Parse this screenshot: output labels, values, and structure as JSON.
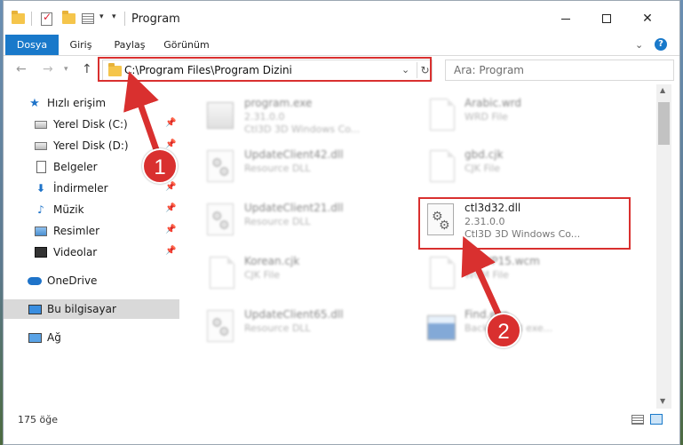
{
  "window": {
    "title": "Program"
  },
  "ribbon": {
    "tabs": [
      {
        "label": "Dosya"
      },
      {
        "label": "Giriş"
      },
      {
        "label": "Paylaş"
      },
      {
        "label": "Görünüm"
      }
    ]
  },
  "navigation": {
    "address": "C:\\Program Files\\Program Dizini",
    "search_placeholder": "Ara: Program"
  },
  "sidebar": {
    "items": [
      {
        "label": "Hızlı erişim",
        "icon": "star-icon"
      },
      {
        "label": "Yerel Disk (C:)",
        "icon": "drive-icon",
        "pinned": true
      },
      {
        "label": "Yerel Disk (D:)",
        "icon": "drive-icon",
        "pinned": true
      },
      {
        "label": "Belgeler",
        "icon": "document-icon",
        "pinned": true
      },
      {
        "label": "İndirmeler",
        "icon": "download-icon",
        "pinned": true
      },
      {
        "label": "Müzik",
        "icon": "music-icon",
        "pinned": true
      },
      {
        "label": "Resimler",
        "icon": "pictures-icon",
        "pinned": true
      },
      {
        "label": "Videolar",
        "icon": "video-icon",
        "pinned": true
      },
      {
        "label": "OneDrive",
        "icon": "cloud-icon"
      },
      {
        "label": "Bu bilgisayar",
        "icon": "computer-icon",
        "selected": true
      },
      {
        "label": "Ağ",
        "icon": "network-icon"
      }
    ]
  },
  "files": [
    {
      "name": "program.exe",
      "line1": "2.31.0.0",
      "line2": "Ctl3D 3D Windows Co...",
      "icon": "exe-icon",
      "blurred": true
    },
    {
      "name": "Arabic.wrd",
      "line1": "WRD File",
      "line2": "",
      "icon": "page-icon",
      "blurred": true
    },
    {
      "name": "UpdateClient42.dll",
      "line1": "Resource DLL",
      "line2": "",
      "icon": "gear-file-icon",
      "blurred": true
    },
    {
      "name": "gbd.cjk",
      "line1": "CJK File",
      "line2": "",
      "icon": "page-icon",
      "blurred": true
    },
    {
      "name": "UpdateClient21.dll",
      "line1": "Resource DLL",
      "line2": "",
      "icon": "gear-file-icon",
      "blurred": true
    },
    {
      "name": "ctl3d32.dll",
      "line1": "2.31.0.0",
      "line2": "Ctl3D 3D Windows Co...",
      "icon": "gear-file-icon",
      "blurred": false
    },
    {
      "name": "Korean.cjk",
      "line1": "CJK File",
      "line2": "",
      "icon": "page-icon",
      "blurred": true
    },
    {
      "name": "WoWP15.wcm",
      "line1": "WCM File",
      "line2": "",
      "icon": "page-icon",
      "blurred": true
    },
    {
      "name": "UpdateClient65.dll",
      "line1": "Resource DLL",
      "line2": "",
      "icon": "gear-file-icon",
      "blurred": true
    },
    {
      "name": "Find.exe",
      "line1": "Background exe...",
      "line2": "",
      "icon": "app-exe-icon",
      "blurred": true
    }
  ],
  "status": {
    "count": "175 öğe"
  },
  "annotations": {
    "marker1": "1",
    "marker2": "2"
  },
  "colors": {
    "accent": "#1979ca",
    "highlight": "#d9302f"
  }
}
